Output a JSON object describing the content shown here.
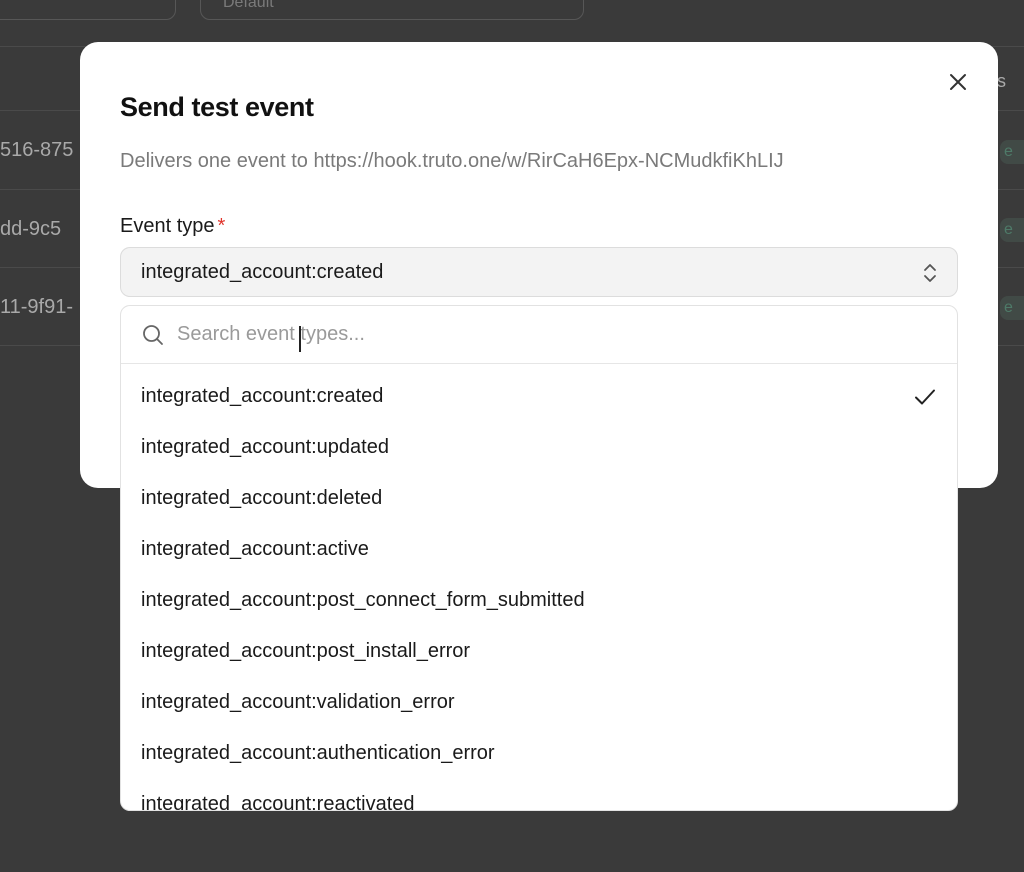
{
  "background": {
    "filter_value": "Default",
    "header_tail": "s",
    "row_ids": [
      "516-875",
      "dd-9c5",
      "11-9f91-"
    ],
    "row_badge_char": "e"
  },
  "modal": {
    "title": "Send test event",
    "description": "Delivers one event to https://hook.truto.one/w/RirCaH6Epx-NCMudkfiKhLIJ",
    "field_label": "Event type",
    "required_mark": "*",
    "selected_value": "integrated_account:created",
    "icons": {
      "close": "close-icon",
      "select": "chevrons-up-down-icon"
    }
  },
  "dropdown": {
    "search_placeholder": "Search event types...",
    "search_value": "",
    "options": [
      {
        "label": "integrated_account:created",
        "selected": true
      },
      {
        "label": "integrated_account:updated",
        "selected": false
      },
      {
        "label": "integrated_account:deleted",
        "selected": false
      },
      {
        "label": "integrated_account:active",
        "selected": false
      },
      {
        "label": "integrated_account:post_connect_form_submitted",
        "selected": false
      },
      {
        "label": "integrated_account:post_install_error",
        "selected": false
      },
      {
        "label": "integrated_account:validation_error",
        "selected": false
      },
      {
        "label": "integrated_account:authentication_error",
        "selected": false
      },
      {
        "label": "integrated_account:reactivated",
        "selected": false
      }
    ],
    "icons": {
      "search": "search-icon",
      "check": "check-icon"
    }
  },
  "colors": {
    "overlay": "#3a3a3a",
    "required": "#e0342b",
    "badge_text": "#4e7a68"
  }
}
